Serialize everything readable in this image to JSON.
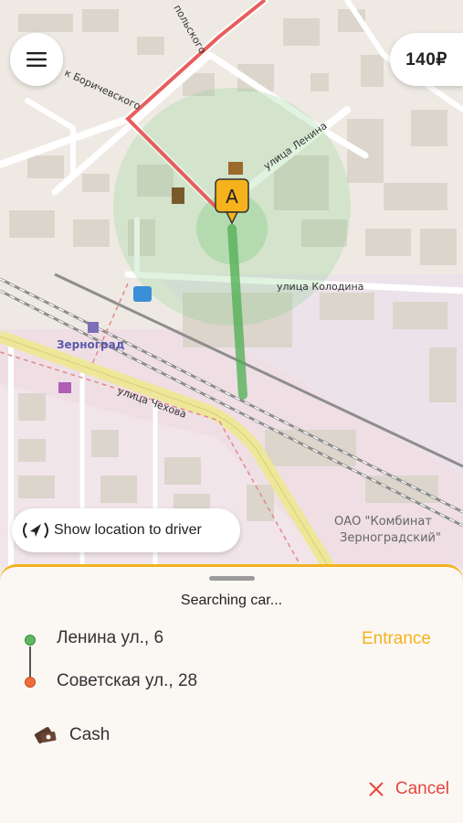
{
  "map": {
    "street_lenina": "улица Ленина",
    "street_kolodina": "улица Колодина",
    "street_chekhova": "улица Чехова",
    "street_borichevskogo": "к Бориче­вского",
    "street_top": "польского",
    "station_label": "Зерноград",
    "factory_label_1": "ОАО \"Комбинат",
    "factory_label_2": "Зерноградский\"",
    "pin_label": "A",
    "route_color": "#e85d5d",
    "walk_color": "#4caf50"
  },
  "header": {
    "price": "140₽"
  },
  "location_button": {
    "label": "Show location to driver"
  },
  "sheet": {
    "status": "Searching car...",
    "from": "Ленина ул., 6",
    "to": "Советская ул., 28",
    "entrance": "Entrance",
    "payment": "Cash",
    "cancel": "Cancel",
    "accent": "#f5b21d",
    "from_color": "#5cb85c",
    "to_color": "#f26b3a"
  }
}
